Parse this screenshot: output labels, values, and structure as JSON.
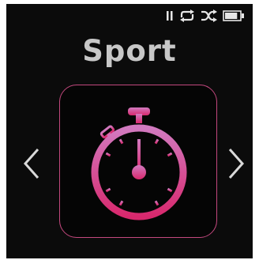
{
  "screen": {
    "title": "Sport",
    "selected_item_icon": "stopwatch-icon"
  },
  "status_bar": {
    "icons": [
      "pause-icon",
      "repeat-icon",
      "shuffle-icon",
      "battery-icon"
    ],
    "battery_level": 0.85
  },
  "navigation": {
    "left_icon": "chevron-left-icon",
    "right_icon": "chevron-right-icon"
  },
  "colors": {
    "background": "#0b0b0b",
    "title": "#c7c7c7",
    "accent_top": "#d27ac0",
    "accent_bottom": "#d8286d",
    "arrow": "#d9d9d9"
  }
}
